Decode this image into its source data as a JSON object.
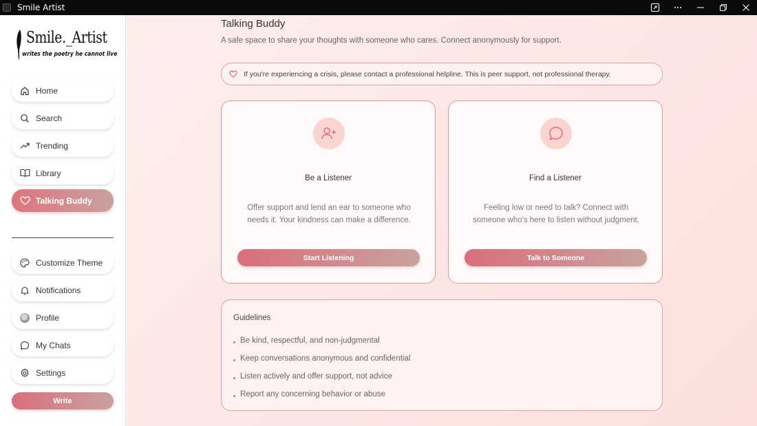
{
  "window": {
    "title": "Smile Artist"
  },
  "logo": {
    "name": "Smile._Artist",
    "tagline": "writes the poetry he cannot live"
  },
  "nav": {
    "items": [
      {
        "label": "Home",
        "icon": "home-icon"
      },
      {
        "label": "Search",
        "icon": "search-icon"
      },
      {
        "label": "Trending",
        "icon": "trending-icon"
      },
      {
        "label": "Library",
        "icon": "book-icon"
      },
      {
        "label": "Talking Buddy",
        "icon": "heart-icon",
        "active": true
      }
    ],
    "secondary": [
      {
        "label": "Customize Theme",
        "icon": "palette-icon"
      },
      {
        "label": "Notifications",
        "icon": "bell-icon"
      },
      {
        "label": "Profile",
        "icon": "avatar"
      },
      {
        "label": "My Chats",
        "icon": "chat-icon"
      },
      {
        "label": "Settings",
        "icon": "gear-icon"
      }
    ],
    "write_label": "Write"
  },
  "main": {
    "title": "Talking Buddy",
    "subtitle": "A safe space to share your thoughts with someone who cares. Connect anonymously for support.",
    "alert": "If you're experiencing a crisis, please contact a professional helpline. This is peer support, not professional therapy.",
    "cards": [
      {
        "title": "Be a Listener",
        "description": "Offer support and lend an ear to someone who needs it. Your kindness can make a difference.",
        "button": "Start Listening",
        "icon": "user-plus-icon"
      },
      {
        "title": "Find a Listener",
        "description": "Feeling low or need to talk? Connect with someone who's here to listen without judgment.",
        "button": "Talk to Someone",
        "icon": "message-circle-icon"
      }
    ],
    "guidelines": {
      "title": "Guidelines",
      "items": [
        "Be kind, respectful, and non-judgmental",
        "Keep conversations anonymous and confidential",
        "Listen actively and offer support, not advice",
        "Report any concerning behavior or abuse"
      ]
    }
  },
  "colors": {
    "accent": "#d86f7c",
    "accent_end": "#c9a29e",
    "background": "#fdeeed",
    "border": "#e0949b"
  }
}
